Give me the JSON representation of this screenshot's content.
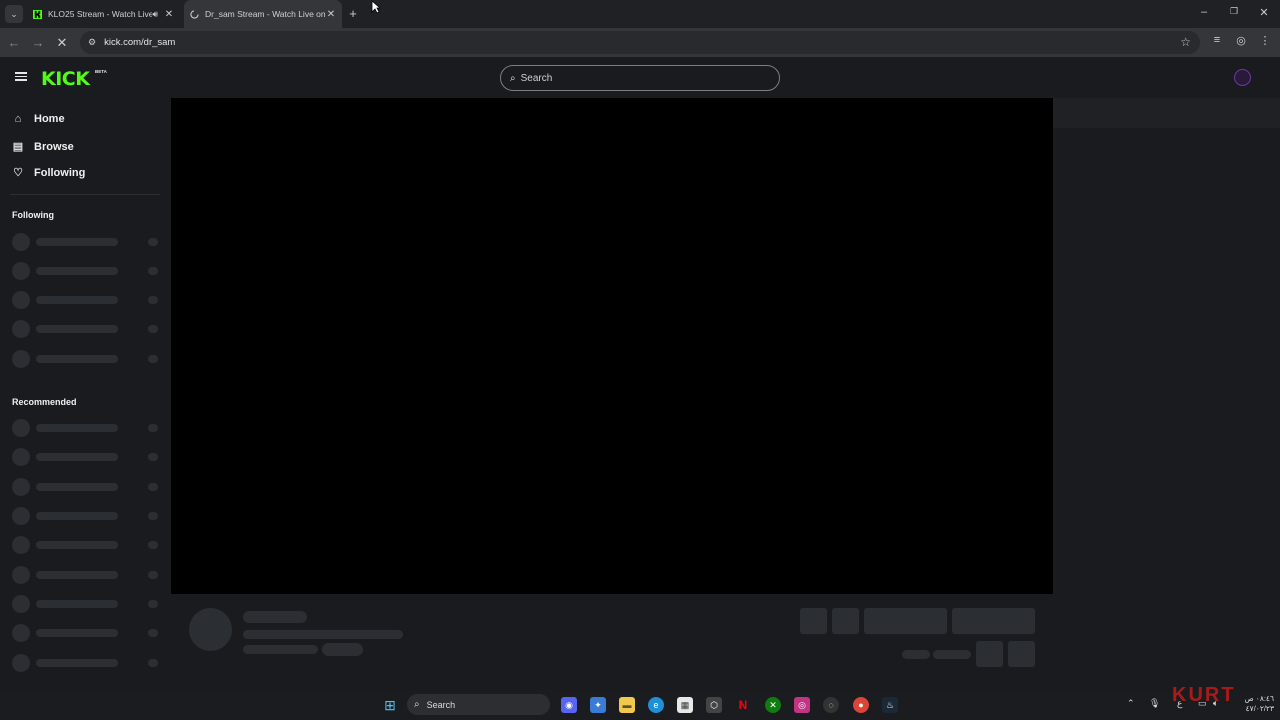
{
  "browser": {
    "tabs": [
      {
        "title": "KLO25 Stream - Watch Live",
        "active": false,
        "favicon": "kick-icon",
        "audio": true
      },
      {
        "title": "Dr_sam Stream - Watch Live on",
        "active": true,
        "favicon": "loading-icon"
      }
    ],
    "url": "kick.com/dr_sam"
  },
  "kick": {
    "logo": "KICK",
    "beta": "BETA",
    "search_placeholder": "Search",
    "nav": {
      "home": "Home",
      "browse": "Browse",
      "following": "Following"
    },
    "following_header": "Following",
    "recommended_header": "Recommended",
    "accent": "#53fc18"
  },
  "taskbar": {
    "search_label": "Search",
    "tray_lang": "ع",
    "clock_time": "٠٨:٤٦ ص",
    "clock_date": "٤٧/٠٢/٢٣",
    "watermark": "KURT"
  }
}
